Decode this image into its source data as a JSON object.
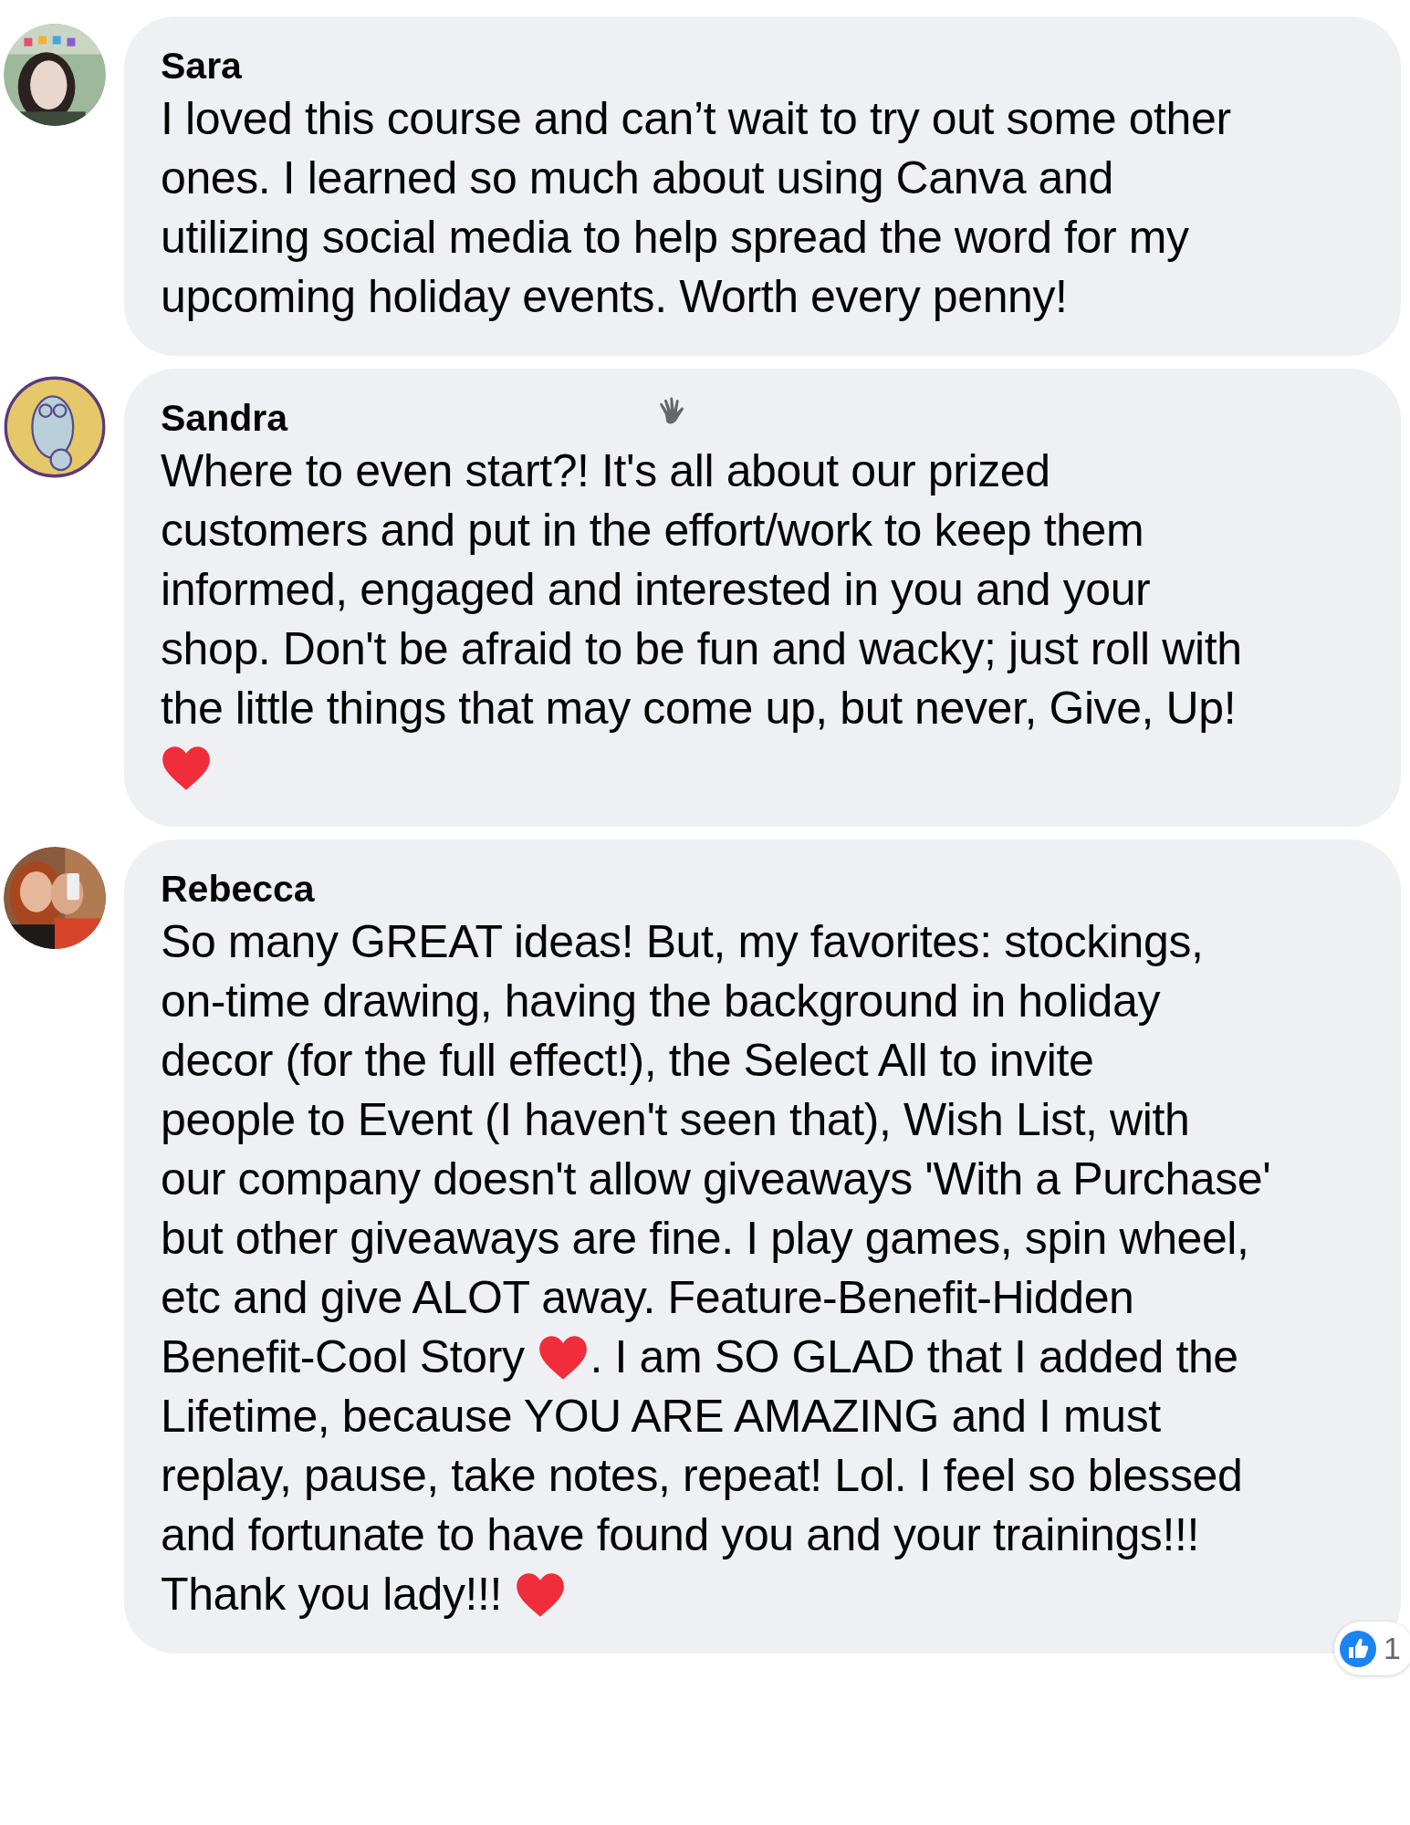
{
  "comments": [
    {
      "author": "Sara",
      "avatar": {
        "kind": "picture"
      },
      "wave": false,
      "lines": [
        [
          {
            "kind": "text",
            "text": "I loved this course and can’t wait to try out some other"
          }
        ],
        [
          {
            "kind": "text",
            "text": "ones. I learned so much about using Canva and"
          }
        ],
        [
          {
            "kind": "text",
            "text": "utilizing social media to help spread the word for my"
          }
        ],
        [
          {
            "kind": "text",
            "text": "upcoming holiday events. Worth every penny!"
          }
        ]
      ]
    },
    {
      "author": "Sandra",
      "avatar": {
        "kind": "picture"
      },
      "wave": true,
      "lines": [
        [
          {
            "kind": "text",
            "text": "Where to even start?! It's all about our prized"
          }
        ],
        [
          {
            "kind": "text",
            "text": "customers and put in the effort/work to keep them"
          }
        ],
        [
          {
            "kind": "text",
            "text": "informed, engaged and interested in you and your"
          }
        ],
        [
          {
            "kind": "text",
            "text": "shop. Don't be afraid to be fun and wacky; just roll with"
          }
        ],
        [
          {
            "kind": "text",
            "text": "the little things that may come up, but never, Give, Up!"
          }
        ],
        [
          {
            "kind": "heart"
          }
        ]
      ]
    },
    {
      "author": "Rebecca",
      "avatar": {
        "kind": "picture"
      },
      "wave": false,
      "lines": [
        [
          {
            "kind": "text",
            "text": "So many GREAT ideas! But, my favorites: stockings,"
          }
        ],
        [
          {
            "kind": "text",
            "text": "on-time drawing, having the background in holiday"
          }
        ],
        [
          {
            "kind": "text",
            "text": "decor (for the full effect!), the Select All to invite"
          }
        ],
        [
          {
            "kind": "text",
            "text": "people to Event (I haven't seen that), Wish List, with"
          }
        ],
        [
          {
            "kind": "text",
            "text": "our company doesn't allow giveaways 'With a Purchase'"
          }
        ],
        [
          {
            "kind": "text",
            "text": "but other giveaways are fine. I play games, spin wheel,"
          }
        ],
        [
          {
            "kind": "text",
            "text": "etc and give ALOT away. Feature-Benefit-Hidden"
          }
        ],
        [
          {
            "kind": "text",
            "text": "Benefit-Cool Story"
          },
          {
            "kind": "heart"
          },
          {
            "kind": "text",
            "text": ". I am SO GLAD that I added the"
          }
        ],
        [
          {
            "kind": "text",
            "text": "Lifetime, because YOU ARE AMAZING and I must"
          }
        ],
        [
          {
            "kind": "text",
            "text": "replay, pause, take notes, repeat! Lol. I feel so blessed"
          }
        ],
        [
          {
            "kind": "text",
            "text": "and fortunate to have found you and your trainings!!!"
          }
        ],
        [
          {
            "kind": "text",
            "text": "Thank you lady!!!"
          },
          {
            "kind": "heart"
          }
        ]
      ],
      "reactions": {
        "count": "1"
      }
    }
  ]
}
